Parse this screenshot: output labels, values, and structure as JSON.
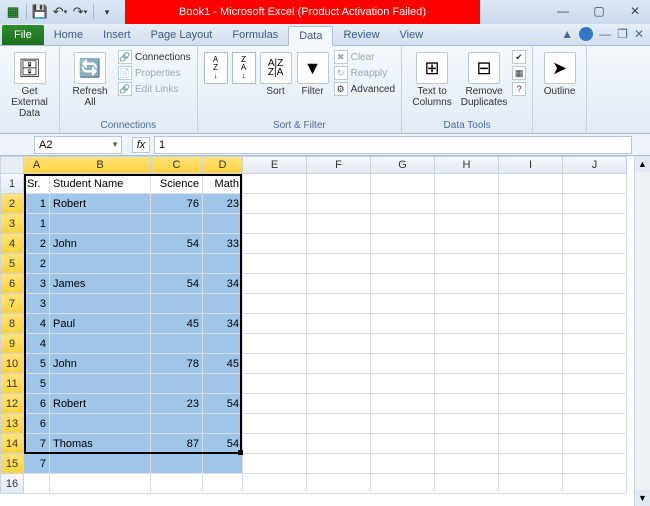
{
  "title": "Book1  -  Microsoft Excel (Product Activation Failed)",
  "tabs": {
    "file": "File",
    "home": "Home",
    "insert": "Insert",
    "pagelayout": "Page Layout",
    "formulas": "Formulas",
    "data": "Data",
    "review": "Review",
    "view": "View"
  },
  "ribbon": {
    "getdata": "Get External Data",
    "refresh": "Refresh All",
    "connections": "Connections",
    "properties": "Properties",
    "editlinks": "Edit Links",
    "grp_connections": "Connections",
    "sort": "Sort",
    "filter": "Filter",
    "clear": "Clear",
    "reapply": "Reapply",
    "advanced": "Advanced",
    "grp_sortfilter": "Sort & Filter",
    "texttocols": "Text to Columns",
    "removedup": "Remove Duplicates",
    "grp_datatools": "Data Tools",
    "outline": "Outline"
  },
  "namebox": "A2",
  "fxvalue": "1",
  "cols": [
    "A",
    "B",
    "C",
    "D",
    "E",
    "F",
    "G",
    "H",
    "I",
    "J"
  ],
  "rows": [
    "1",
    "2",
    "3",
    "4",
    "5",
    "6",
    "7",
    "8",
    "9",
    "10",
    "11",
    "12",
    "13",
    "14",
    "15",
    "16"
  ],
  "headers": {
    "a": "Sr.",
    "b": "Student Name",
    "c": "Science",
    "d": "Math"
  },
  "data": [
    {
      "sr": "1",
      "name": "Robert",
      "sci": "76",
      "math": "23"
    },
    {
      "sr": "1",
      "name": "",
      "sci": "",
      "math": ""
    },
    {
      "sr": "2",
      "name": "John",
      "sci": "54",
      "math": "33"
    },
    {
      "sr": "2",
      "name": "",
      "sci": "",
      "math": ""
    },
    {
      "sr": "3",
      "name": "James",
      "sci": "54",
      "math": "34"
    },
    {
      "sr": "3",
      "name": "",
      "sci": "",
      "math": ""
    },
    {
      "sr": "4",
      "name": "Paul",
      "sci": "45",
      "math": "34"
    },
    {
      "sr": "4",
      "name": "",
      "sci": "",
      "math": ""
    },
    {
      "sr": "5",
      "name": "John",
      "sci": "78",
      "math": "45"
    },
    {
      "sr": "5",
      "name": "",
      "sci": "",
      "math": ""
    },
    {
      "sr": "6",
      "name": "Robert",
      "sci": "23",
      "math": "54"
    },
    {
      "sr": "6",
      "name": "",
      "sci": "",
      "math": ""
    },
    {
      "sr": "7",
      "name": "Thomas",
      "sci": "87",
      "math": "54"
    },
    {
      "sr": "7",
      "name": "",
      "sci": "",
      "math": ""
    }
  ]
}
